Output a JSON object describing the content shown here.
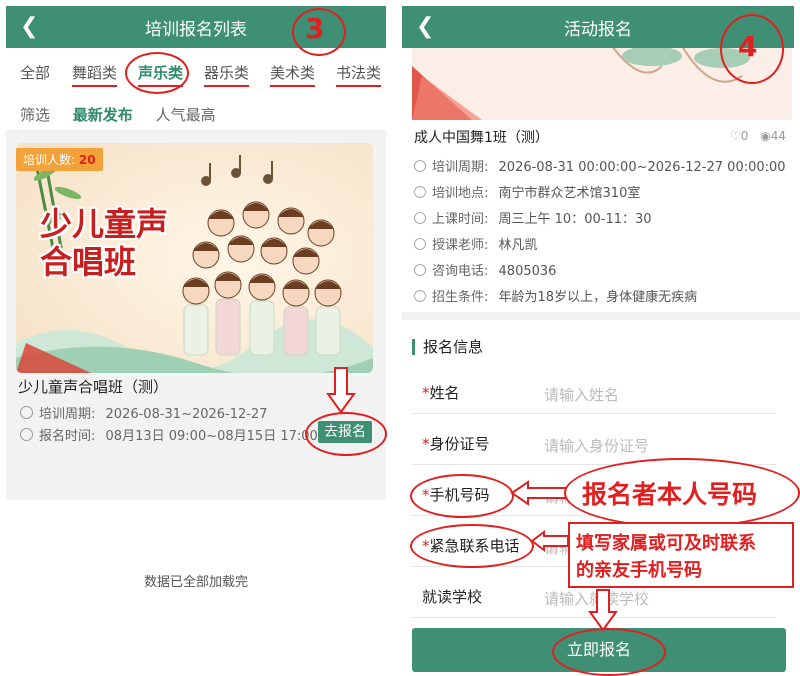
{
  "left": {
    "nav_title": "培训报名列表",
    "back_icon": "chevron-left-icon",
    "step_number": "3",
    "categories": [
      "全部",
      "舞蹈类",
      "声乐类",
      "器乐类",
      "美术类",
      "书法类"
    ],
    "filters": [
      "筛选",
      "最新发布",
      "人气最高"
    ],
    "card": {
      "badge_label": "培训人数:",
      "badge_count": "20",
      "poster_line1": "少儿童声",
      "poster_line2": "合唱班",
      "title": "少儿童声合唱班（测）",
      "period_label": "培训周期:",
      "period_value": "2026-08-31~2026-12-27",
      "signup_label": "报名时间:",
      "signup_value": "08月13日 09:00~08月15日 17:00",
      "go_button": "去报名"
    },
    "footer_note": "数据已全部加载完"
  },
  "right": {
    "nav_title": "活动报名",
    "back_icon": "chevron-left-icon",
    "step_number": "4",
    "course_title": "成人中国舞1班（测）",
    "likes": "0",
    "views": "44",
    "info": [
      {
        "label": "培训周期:",
        "value": "2026-08-31 00:00:00~2026-12-27 00:00:00",
        "icon": "clock-icon"
      },
      {
        "label": "培训地点:",
        "value": "南宁市群众艺术馆310室",
        "icon": "location-icon"
      },
      {
        "label": "上课时间:",
        "value": "周三上午 10：00-11：30",
        "icon": "clock-icon"
      },
      {
        "label": "授课老师:",
        "value": "林凡凯",
        "icon": "teacher-icon"
      },
      {
        "label": "咨询电话:",
        "value": "4805036",
        "icon": "phone-icon"
      },
      {
        "label": "招生条件:",
        "value": "年龄为18岁以上，身体健康无疾病",
        "icon": "tag-icon"
      }
    ],
    "section_title": "报名信息",
    "fields": [
      {
        "required": "*",
        "label": "姓名",
        "placeholder": "请输入姓名"
      },
      {
        "required": "*",
        "label": "身份证号",
        "placeholder": "请输入身份证号"
      },
      {
        "required": "*",
        "label": "手机号码",
        "placeholder": "请输"
      },
      {
        "required": "*",
        "label": "紧急联系电话",
        "placeholder": "请输"
      },
      {
        "required": "",
        "label": "就读学校",
        "placeholder": "请输入就读学校"
      }
    ],
    "submit_button": "立即报名",
    "callout_phone": "报名者本人号码",
    "callout_emergency_line1": "填写家属或可及时联系",
    "callout_emergency_line2": "的亲友手机号码"
  },
  "colors": {
    "primary": "#3f8f74",
    "annotation": "#e02020",
    "badge": "#f3a23a"
  }
}
